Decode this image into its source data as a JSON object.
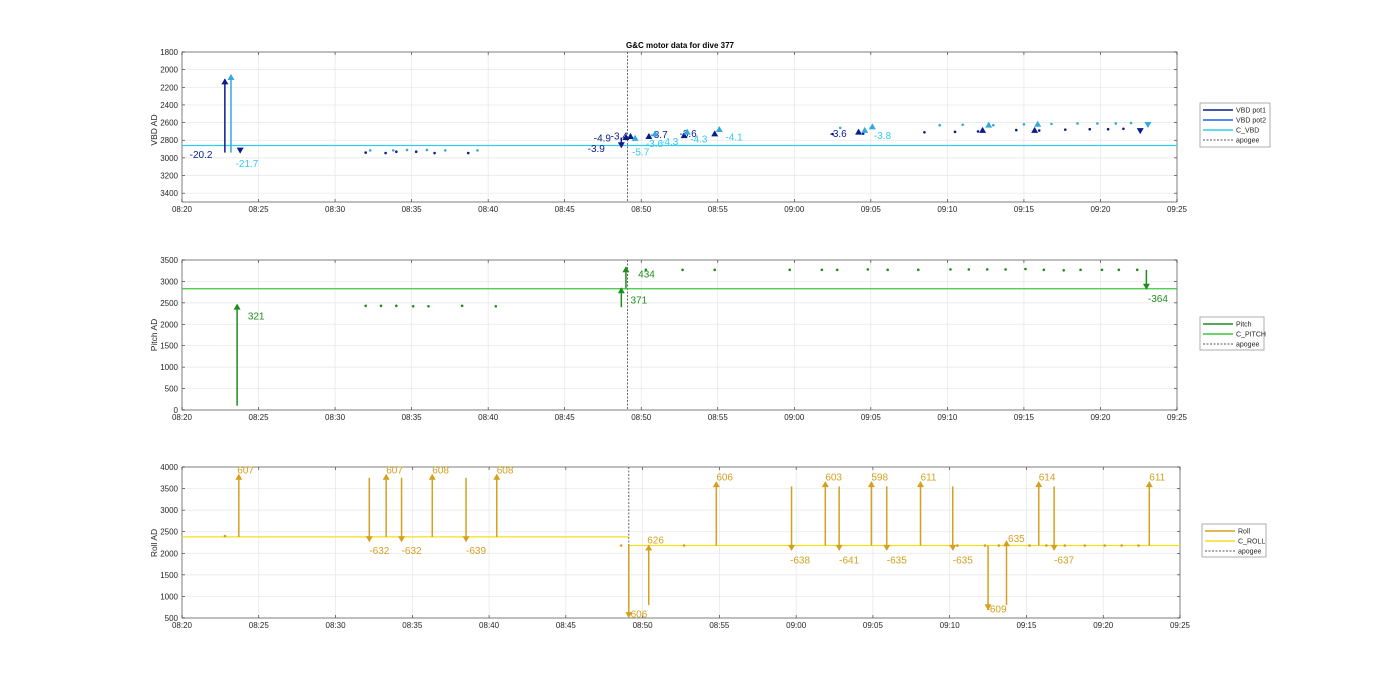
{
  "figure": {
    "title": "G&C motor data for dive 377",
    "colors": {
      "vbd_pot1": "#0a1c8c",
      "vbd_pot2": "#1a66dd",
      "c_vbd": "#33ccee",
      "vbd_pot2_marker": "#33aadd",
      "pitch": "#1e8c1e",
      "c_pitch": "#3dc63d",
      "roll": "#d4a020",
      "c_roll": "#f2e020",
      "apogee": "#555555",
      "grid": "#e6e6e6"
    }
  },
  "chart_data": [
    {
      "type": "line",
      "id": "vbd",
      "title": "G&C motor data for dive 377",
      "ylabel": "VBD AD",
      "xlabel": "",
      "x_ticks": [
        "08:20",
        "08:25",
        "08:30",
        "08:35",
        "08:40",
        "08:45",
        "08:50",
        "08:55",
        "09:00",
        "09:05",
        "09:10",
        "09:15",
        "09:20",
        "09:25"
      ],
      "y_ticks": [
        1800,
        2000,
        2200,
        2400,
        2600,
        2800,
        3000,
        3200,
        3400
      ],
      "ylim": [
        1800,
        3500
      ],
      "y_reversed": true,
      "xlim_min": [
        0,
        65
      ],
      "grid": true,
      "legend": {
        "placement": "outside-right",
        "entries": [
          "VBD pot1",
          "VBD pot2",
          "C_VBD",
          "apogee"
        ]
      },
      "reference_line": {
        "name": "C_VBD",
        "value": 2860
      },
      "apogee_min": 29.1,
      "pot1_dots": [
        [
          12,
          2940
        ],
        [
          13.3,
          2945
        ],
        [
          14,
          2930
        ],
        [
          15.3,
          2930
        ],
        [
          16.5,
          2945
        ],
        [
          18.7,
          2945
        ],
        [
          42.5,
          2730
        ],
        [
          44.5,
          2725
        ],
        [
          48.5,
          2710
        ],
        [
          50.5,
          2705
        ],
        [
          52,
          2700
        ],
        [
          54.5,
          2685
        ],
        [
          56,
          2690
        ],
        [
          57.7,
          2680
        ],
        [
          59.3,
          2675
        ],
        [
          60.5,
          2675
        ],
        [
          61.5,
          2670
        ]
      ],
      "pot2_dots": [
        [
          12.3,
          2915
        ],
        [
          13.8,
          2915
        ],
        [
          14.7,
          2910
        ],
        [
          16,
          2910
        ],
        [
          17.2,
          2915
        ],
        [
          19.3,
          2915
        ],
        [
          43,
          2660
        ],
        [
          45,
          2660
        ],
        [
          49.5,
          2630
        ],
        [
          51,
          2625
        ],
        [
          53,
          2630
        ],
        [
          55,
          2620
        ],
        [
          56.8,
          2615
        ],
        [
          58.5,
          2610
        ],
        [
          59.8,
          2610
        ],
        [
          61,
          2610
        ],
        [
          62,
          2605
        ]
      ],
      "vbd_moves": [
        {
          "t": 2.8,
          "start": 2940,
          "end": 2110,
          "color": "pot1",
          "dir": "down",
          "label": "-20.2",
          "label_pos": [
            0.5,
            2970
          ],
          "label_color": "pot1"
        },
        {
          "t": 3.2,
          "start": 2940,
          "end": 2060,
          "color": "pot2",
          "dir": "down",
          "label": "-21.7",
          "label_pos": [
            3.5,
            3070
          ],
          "label_color": "c_vbd"
        },
        {
          "t": 3.8,
          "start": 2900,
          "end": 2940,
          "color": "pot1",
          "dir": "down",
          "label": "",
          "label_pos": [
            0,
            0
          ],
          "label_color": "pot1"
        },
        {
          "t": 28.7,
          "start": 2770,
          "end": 2880,
          "color": "pot1",
          "dir": "up",
          "label": "-3.9",
          "label_pos": [
            26.5,
            2900
          ],
          "label_color": "pot1"
        },
        {
          "t": 29.0,
          "start": 2800,
          "end": 2740,
          "color": "pot1",
          "dir": "up",
          "label": "-4.9",
          "label_pos": [
            26.9,
            2780
          ],
          "label_color": "pot1"
        },
        {
          "t": 29.3,
          "start": 2780,
          "end": 2730,
          "color": "pot1",
          "dir": "up",
          "label": "-3.4",
          "label_pos": [
            28.0,
            2760
          ],
          "label_color": "pot1"
        },
        {
          "t": 29.6,
          "start": 2790,
          "end": 2750,
          "color": "pot2",
          "dir": "up",
          "label": "-5.7",
          "label_pos": [
            29.4,
            2940
          ],
          "label_color": "c_vbd"
        },
        {
          "t": 30.5,
          "start": 2780,
          "end": 2730,
          "color": "pot1",
          "dir": "up",
          "label": "-3.7",
          "label_pos": [
            30.6,
            2740
          ],
          "label_color": "pot1"
        },
        {
          "t": 30.9,
          "start": 2750,
          "end": 2700,
          "color": "pot2",
          "dir": "up",
          "label": "-3.6",
          "label_pos": [
            30.3,
            2840
          ],
          "label_color": "c_vbd"
        },
        {
          "t": 32.8,
          "start": 2760,
          "end": 2720,
          "color": "pot1",
          "dir": "up",
          "label": "-3.6",
          "label_pos": [
            32.5,
            2730
          ],
          "label_color": "pot1"
        },
        {
          "t": 33.0,
          "start": 2720,
          "end": 2680,
          "color": "pot2",
          "dir": "up",
          "label": "-4.3",
          "label_pos": [
            31.3,
            2820
          ],
          "label_color": "c_vbd"
        },
        {
          "t": 34.8,
          "start": 2740,
          "end": 2700,
          "color": "pot1",
          "dir": "up",
          "label": "-4.3",
          "label_pos": [
            33.2,
            2790
          ],
          "label_color": "c_vbd"
        },
        {
          "t": 35.1,
          "start": 2690,
          "end": 2650,
          "color": "pot2",
          "dir": "up",
          "label": "-4.1",
          "label_pos": [
            35.5,
            2770
          ],
          "label_color": "c_vbd"
        },
        {
          "t": 44.2,
          "start": 2710,
          "end": 2680,
          "color": "pot1",
          "dir": "up",
          "label": "-3.6",
          "label_pos": [
            42.3,
            2730
          ],
          "label_color": "pot1"
        },
        {
          "t": 44.6,
          "start": 2690,
          "end": 2660,
          "color": "pot2",
          "dir": "up",
          "label": "",
          "label_pos": [
            0,
            0
          ],
          "label_color": "c_vbd"
        },
        {
          "t": 45.1,
          "start": 2650,
          "end": 2620,
          "color": "pot2",
          "dir": "up",
          "label": "-3.8",
          "label_pos": [
            45.2,
            2750
          ],
          "label_color": "c_vbd"
        },
        {
          "t": 52.3,
          "start": 2700,
          "end": 2660,
          "color": "pot1",
          "dir": "up",
          "label": "",
          "label_pos": [
            0,
            0
          ],
          "label_color": "pot1"
        },
        {
          "t": 52.7,
          "start": 2640,
          "end": 2600,
          "color": "pot2",
          "dir": "up",
          "label": "",
          "label_pos": [
            0,
            0
          ],
          "label_color": "c_vbd"
        },
        {
          "t": 55.7,
          "start": 2700,
          "end": 2660,
          "color": "pot1",
          "dir": "up",
          "label": "",
          "label_pos": [
            0,
            0
          ],
          "label_color": "pot1"
        },
        {
          "t": 55.9,
          "start": 2630,
          "end": 2590,
          "color": "pot2",
          "dir": "up",
          "label": "",
          "label_pos": [
            0,
            0
          ],
          "label_color": "c_vbd"
        },
        {
          "t": 62.6,
          "start": 2670,
          "end": 2720,
          "color": "pot1",
          "dir": "down",
          "label": "",
          "label_pos": [
            0,
            0
          ],
          "label_color": "pot1"
        },
        {
          "t": 63.1,
          "start": 2600,
          "end": 2650,
          "color": "pot2",
          "dir": "down",
          "label": "",
          "label_pos": [
            0,
            0
          ],
          "label_color": "c_vbd"
        }
      ]
    },
    {
      "type": "line",
      "id": "pitch",
      "ylabel": "Pitch AD",
      "xlabel": "",
      "x_ticks": [
        "08:20",
        "08:25",
        "08:30",
        "08:35",
        "08:40",
        "08:45",
        "08:50",
        "08:55",
        "09:00",
        "09:05",
        "09:10",
        "09:15",
        "09:20",
        "09:25"
      ],
      "y_ticks": [
        0,
        500,
        1000,
        1500,
        2000,
        2500,
        3000,
        3500
      ],
      "ylim": [
        0,
        3500
      ],
      "y_reversed": false,
      "grid": true,
      "legend": {
        "placement": "outside-right",
        "entries": [
          "Pitch",
          "C_PITCH",
          "apogee"
        ]
      },
      "reference_line": {
        "name": "C_PITCH",
        "value": 2830
      },
      "apogee_min": 29.1,
      "dots": [
        [
          12,
          2430
        ],
        [
          13,
          2430
        ],
        [
          14,
          2430
        ],
        [
          15.1,
          2420
        ],
        [
          16.1,
          2420
        ],
        [
          18.3,
          2430
        ],
        [
          20.5,
          2420
        ],
        [
          30.3,
          3270
        ],
        [
          32.7,
          3270
        ],
        [
          34.8,
          3270
        ],
        [
          39.7,
          3270
        ],
        [
          41.8,
          3270
        ],
        [
          42.8,
          3270
        ],
        [
          44.8,
          3280
        ],
        [
          46.1,
          3270
        ],
        [
          48.1,
          3270
        ],
        [
          50.2,
          3280
        ],
        [
          51.4,
          3280
        ],
        [
          52.6,
          3280
        ],
        [
          53.8,
          3280
        ],
        [
          55.1,
          3290
        ],
        [
          56.3,
          3270
        ],
        [
          57.6,
          3260
        ],
        [
          58.7,
          3270
        ],
        [
          60.1,
          3270
        ],
        [
          61.2,
          3270
        ],
        [
          62.4,
          3270
        ]
      ],
      "moves": [
        {
          "t": 3.6,
          "start": 100,
          "end": 2460,
          "dir": "up",
          "label": "321",
          "label_pos": [
            4.3,
            2180
          ]
        },
        {
          "t": 28.7,
          "start": 2400,
          "end": 2840,
          "dir": "up",
          "label": "371",
          "label_pos": [
            29.3,
            2550
          ]
        },
        {
          "t": 29.0,
          "start": 2840,
          "end": 3330,
          "dir": "up",
          "label": "434",
          "label_pos": [
            29.8,
            3160
          ]
        },
        {
          "t": 63.0,
          "start": 3270,
          "end": 2830,
          "dir": "down",
          "label": "-364",
          "label_pos": [
            63.1,
            2590
          ]
        }
      ]
    },
    {
      "type": "line",
      "id": "roll",
      "ylabel": "Roll AD",
      "xlabel": "",
      "x_ticks": [
        "08:20",
        "08:25",
        "08:30",
        "08:35",
        "08:40",
        "08:45",
        "08:50",
        "08:55",
        "09:00",
        "09:05",
        "09:10",
        "09:15",
        "09:20",
        "09:25"
      ],
      "y_ticks": [
        500,
        1000,
        1500,
        2000,
        2500,
        3000,
        3500,
        4000
      ],
      "ylim": [
        500,
        4000
      ],
      "y_reversed": false,
      "grid": true,
      "legend": {
        "placement": "outside-right",
        "entries": [
          "Roll",
          "C_ROLL",
          "apogee"
        ]
      },
      "ref_before": {
        "name": "C_ROLL",
        "value": 2380,
        "until_min": 29.1
      },
      "ref_after": {
        "name": "C_ROLL",
        "value": 2180
      },
      "apogee_min": 29.1,
      "dots": [
        [
          2.8,
          2400
        ],
        [
          28.6,
          2180
        ],
        [
          32.7,
          2180
        ],
        [
          50.5,
          2180
        ],
        [
          52.3,
          2180
        ],
        [
          53.2,
          2180
        ],
        [
          55.2,
          2180
        ],
        [
          56.3,
          2180
        ],
        [
          57.5,
          2180
        ],
        [
          58.8,
          2180
        ],
        [
          60.1,
          2180
        ],
        [
          61.2,
          2180
        ],
        [
          62.3,
          2180
        ]
      ],
      "moves": [
        {
          "t": 3.7,
          "start": 2380,
          "end": 3820,
          "dir": "up",
          "label": "607",
          "label_pos": [
            3.6,
            3920
          ]
        },
        {
          "t": 12.2,
          "start": 3750,
          "end": 2280,
          "dir": "down",
          "label": "-632",
          "label_pos": [
            12.2,
            2050
          ]
        },
        {
          "t": 13.3,
          "start": 2380,
          "end": 3820,
          "dir": "up",
          "label": "607",
          "label_pos": [
            13.3,
            3920
          ]
        },
        {
          "t": 14.3,
          "start": 3750,
          "end": 2280,
          "dir": "down",
          "label": "-632",
          "label_pos": [
            14.3,
            2050
          ]
        },
        {
          "t": 16.3,
          "start": 2380,
          "end": 3820,
          "dir": "up",
          "label": "608",
          "label_pos": [
            16.3,
            3920
          ]
        },
        {
          "t": 18.5,
          "start": 3750,
          "end": 2280,
          "dir": "down",
          "label": "-639",
          "label_pos": [
            18.5,
            2050
          ]
        },
        {
          "t": 20.5,
          "start": 2380,
          "end": 3820,
          "dir": "up",
          "label": "608",
          "label_pos": [
            20.5,
            3920
          ]
        },
        {
          "t": 29.1,
          "start": 2200,
          "end": 520,
          "dir": "down",
          "label": "-606",
          "label_pos": [
            29.0,
            580
          ]
        },
        {
          "t": 30.4,
          "start": 800,
          "end": 2180,
          "dir": "up",
          "label": "626",
          "label_pos": [
            30.3,
            2300
          ]
        },
        {
          "t": 34.8,
          "start": 2180,
          "end": 3650,
          "dir": "up",
          "label": "606",
          "label_pos": [
            34.8,
            3760
          ]
        },
        {
          "t": 39.7,
          "start": 3550,
          "end": 2080,
          "dir": "down",
          "label": "-638",
          "label_pos": [
            39.6,
            1830
          ]
        },
        {
          "t": 41.9,
          "start": 2180,
          "end": 3650,
          "dir": "up",
          "label": "603",
          "label_pos": [
            41.9,
            3760
          ]
        },
        {
          "t": 42.8,
          "start": 3550,
          "end": 2080,
          "dir": "down",
          "label": "-641",
          "label_pos": [
            42.8,
            1830
          ]
        },
        {
          "t": 44.9,
          "start": 2180,
          "end": 3650,
          "dir": "up",
          "label": "598",
          "label_pos": [
            44.9,
            3760
          ]
        },
        {
          "t": 45.9,
          "start": 3550,
          "end": 2080,
          "dir": "down",
          "label": "-635",
          "label_pos": [
            45.9,
            1830
          ]
        },
        {
          "t": 48.1,
          "start": 2180,
          "end": 3650,
          "dir": "up",
          "label": "611",
          "label_pos": [
            48.1,
            3760
          ]
        },
        {
          "t": 50.2,
          "start": 3550,
          "end": 2080,
          "dir": "down",
          "label": "-635",
          "label_pos": [
            50.2,
            1830
          ]
        },
        {
          "t": 52.5,
          "start": 2180,
          "end": 700,
          "dir": "down",
          "label": "-609",
          "label_pos": [
            52.4,
            700
          ]
        },
        {
          "t": 53.7,
          "start": 800,
          "end": 2280,
          "dir": "up",
          "label": "635",
          "label_pos": [
            53.8,
            2330
          ]
        },
        {
          "t": 55.8,
          "start": 2180,
          "end": 3650,
          "dir": "up",
          "label": "614",
          "label_pos": [
            55.8,
            3760
          ]
        },
        {
          "t": 56.8,
          "start": 3550,
          "end": 2080,
          "dir": "down",
          "label": "-637",
          "label_pos": [
            56.8,
            1830
          ]
        },
        {
          "t": 63.0,
          "start": 2180,
          "end": 3650,
          "dir": "up",
          "label": "611",
          "label_pos": [
            63.0,
            3760
          ]
        }
      ]
    }
  ]
}
